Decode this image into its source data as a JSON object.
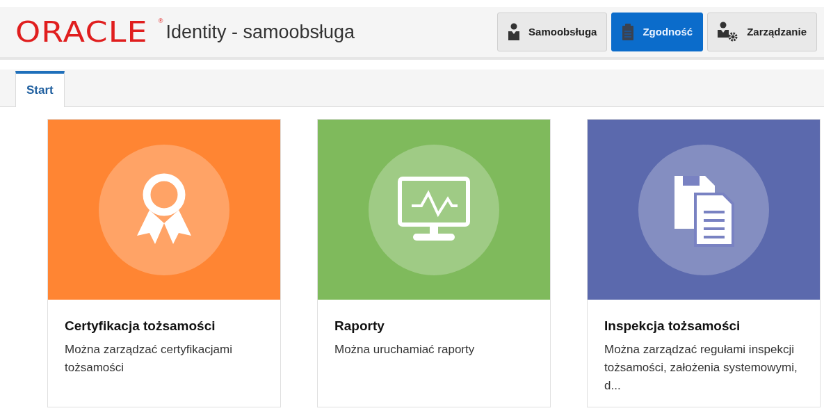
{
  "header": {
    "logo": "ORACLE",
    "logo_mark": "®",
    "title": "Identity - samoobsługa"
  },
  "nav_buttons": [
    {
      "label": "Samoobsługa",
      "kind": "person",
      "selected": false
    },
    {
      "label": "Zgodność",
      "kind": "clipboard",
      "selected": true
    },
    {
      "label": "Zarządzanie",
      "kind": "admin",
      "selected": false
    }
  ],
  "tabs": [
    {
      "label": "Start",
      "selected": true
    }
  ],
  "cards": [
    {
      "kind": "award",
      "color": "#ff8533",
      "title": "Certyfikacja tożsamości",
      "description": "Można zarządzać certyfikacjami tożsamości"
    },
    {
      "kind": "monitor",
      "color": "#7fba5c",
      "title": "Raporty",
      "description": "Można uruchamiać raporty"
    },
    {
      "kind": "documents",
      "color": "#5b69ad",
      "title": "Inspekcja tożsamości",
      "description": "Można zarządzać regułami inspekcji tożsamości, założenia systemowymi, d..."
    }
  ]
}
